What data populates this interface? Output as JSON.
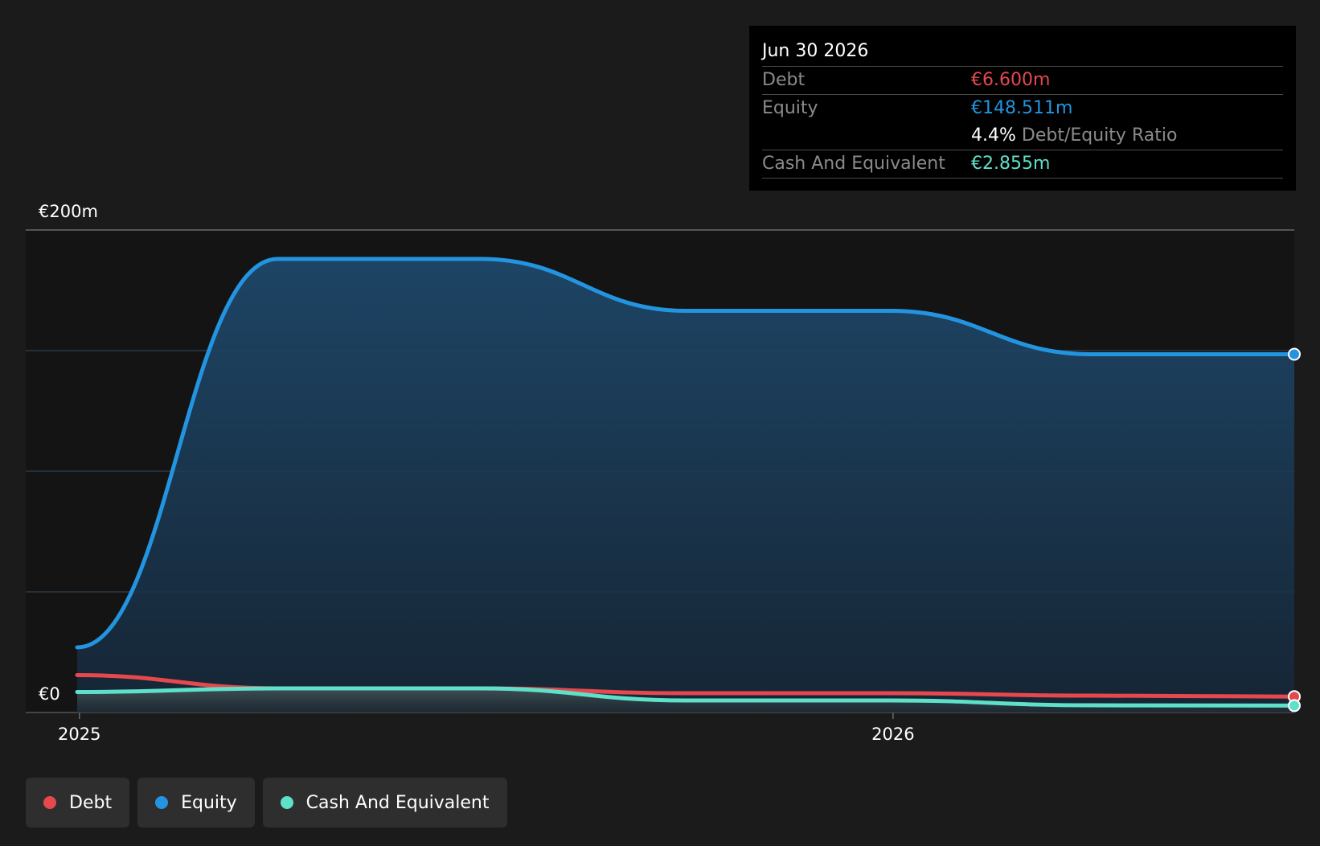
{
  "colors": {
    "debt": "#e5484d",
    "equity": "#2394e0",
    "cash": "#5fe0c8"
  },
  "tooltip": {
    "date": "Jun 30 2026",
    "rows": [
      {
        "label": "Debt",
        "value": "€6.600m",
        "color_key": "debt"
      },
      {
        "label": "Equity",
        "value": "€148.511m",
        "color_key": "equity"
      },
      {
        "label": "Cash And Equivalent",
        "value": "€2.855m",
        "color_key": "cash"
      }
    ],
    "ratio_value": "4.4%",
    "ratio_label": "Debt/Equity Ratio"
  },
  "chart_data": {
    "type": "area",
    "y_axis": {
      "top_label": "€200m",
      "bottom_label": "€0",
      "range": [
        0,
        200
      ],
      "unit": "€m"
    },
    "x_axis": {
      "tick_labels": [
        "2025",
        "2026"
      ],
      "tick_positions": [
        "2025-01-01",
        "2026-01-01"
      ]
    },
    "grid": true,
    "x": [
      "2024-12-31",
      "2025-03-31",
      "2025-06-30",
      "2025-09-30",
      "2025-12-31",
      "2026-03-31",
      "2026-06-30"
    ],
    "series": [
      {
        "name": "Debt",
        "color_key": "debt",
        "values": [
          15.5,
          10.0,
          10.0,
          8.0,
          8.0,
          7.0,
          6.6
        ]
      },
      {
        "name": "Equity",
        "color_key": "equity",
        "values": [
          27.0,
          188.0,
          188.0,
          166.5,
          166.5,
          148.5,
          148.5
        ]
      },
      {
        "name": "Cash And Equivalent",
        "color_key": "cash",
        "values": [
          8.5,
          10.0,
          10.0,
          5.0,
          5.0,
          3.0,
          2.855
        ]
      }
    ],
    "legend": {
      "position": "bottom-left",
      "items": [
        "Debt",
        "Equity",
        "Cash And Equivalent"
      ]
    }
  }
}
